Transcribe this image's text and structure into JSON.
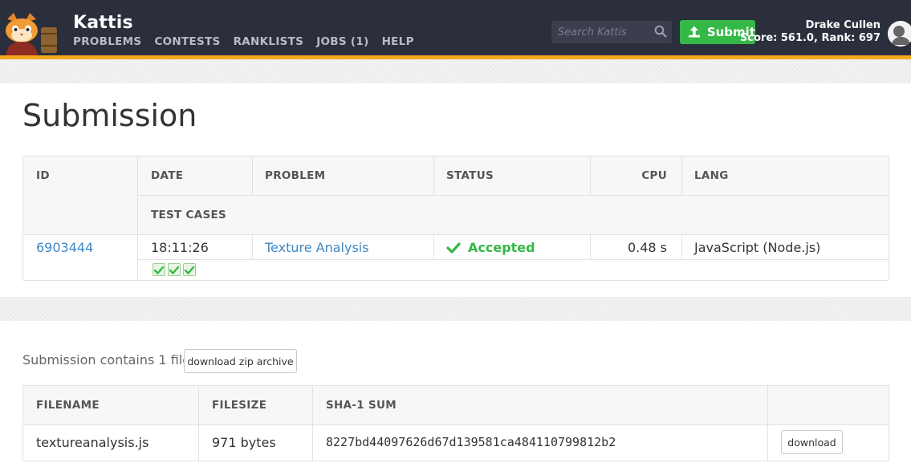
{
  "header": {
    "brand": "Kattis",
    "nav": [
      "PROBLEMS",
      "CONTESTS",
      "RANKLISTS",
      "JOBS (1)",
      "HELP"
    ],
    "search_placeholder": "Search Kattis",
    "submit_label": "Submit",
    "user_name": "Drake Cullen",
    "user_stats": "Score: 561.0, Rank: 697",
    "accent_color": "#f4a81f",
    "bar_color": "#2b2e3b"
  },
  "page": {
    "title": "Submission"
  },
  "submission_table": {
    "headers": {
      "id": "ID",
      "date": "DATE",
      "problem": "PROBLEM",
      "status": "STATUS",
      "cpu": "CPU",
      "lang": "LANG",
      "test_cases": "TEST CASES"
    },
    "row": {
      "id": "6903444",
      "date": "18:11:26",
      "problem": "Texture Analysis",
      "status": "Accepted",
      "cpu": "0.48 s",
      "lang": "JavaScript (Node.js)",
      "test_case_count": 3,
      "status_color": "#34b846"
    }
  },
  "files": {
    "contains_text": "Submission contains 1 file:",
    "zip_button": "download zip archive",
    "headers": {
      "filename": "FILENAME",
      "filesize": "FILESIZE",
      "sha1": "SHA-1 SUM"
    },
    "rows": [
      {
        "filename": "textureanalysis.js",
        "filesize": "971 bytes",
        "sha1": "8227bd44097626d67d139581ca484110799812b2",
        "download_label": "download"
      }
    ]
  }
}
